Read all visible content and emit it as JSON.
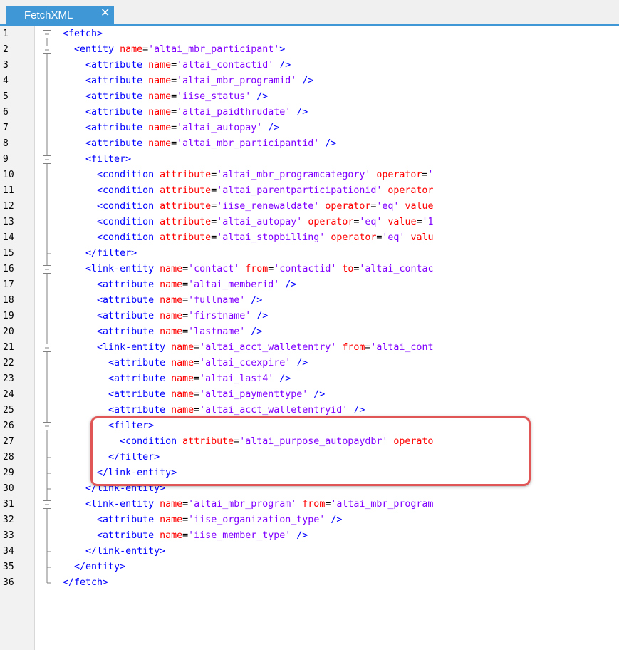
{
  "tab": {
    "label": "FetchXML",
    "close_glyph": "✕"
  },
  "colors": {
    "tag": "#0000ff",
    "attr_name": "#ff0000",
    "attr_value": "#8000ff",
    "highlight": "#e05555",
    "tab": "#3f97d6"
  },
  "lines": [
    {
      "num": "1",
      "indent": 0,
      "fold": "start",
      "tokens": [
        [
          "t",
          "<fetch>"
        ]
      ]
    },
    {
      "num": "2",
      "indent": 2,
      "fold": "start",
      "tokens": [
        [
          "t",
          "<entity"
        ],
        [
          "tx",
          " "
        ],
        [
          "a",
          "name"
        ],
        [
          "tx",
          "="
        ],
        [
          "v",
          "'altai_mbr_participant'"
        ],
        [
          "t",
          ">"
        ]
      ]
    },
    {
      "num": "3",
      "indent": 4,
      "fold": "line",
      "tokens": [
        [
          "t",
          "<attribute"
        ],
        [
          "tx",
          " "
        ],
        [
          "a",
          "name"
        ],
        [
          "tx",
          "="
        ],
        [
          "v",
          "'altai_contactid'"
        ],
        [
          "tx",
          " "
        ],
        [
          "t",
          "/>"
        ]
      ]
    },
    {
      "num": "4",
      "indent": 4,
      "fold": "line",
      "tokens": [
        [
          "t",
          "<attribute"
        ],
        [
          "tx",
          " "
        ],
        [
          "a",
          "name"
        ],
        [
          "tx",
          "="
        ],
        [
          "v",
          "'altai_mbr_programid'"
        ],
        [
          "tx",
          " "
        ],
        [
          "t",
          "/>"
        ]
      ]
    },
    {
      "num": "5",
      "indent": 4,
      "fold": "line",
      "tokens": [
        [
          "t",
          "<attribute"
        ],
        [
          "tx",
          " "
        ],
        [
          "a",
          "name"
        ],
        [
          "tx",
          "="
        ],
        [
          "v",
          "'iise_status'"
        ],
        [
          "tx",
          " "
        ],
        [
          "t",
          "/>"
        ]
      ]
    },
    {
      "num": "6",
      "indent": 4,
      "fold": "line",
      "tokens": [
        [
          "t",
          "<attribute"
        ],
        [
          "tx",
          " "
        ],
        [
          "a",
          "name"
        ],
        [
          "tx",
          "="
        ],
        [
          "v",
          "'altai_paidthrudate'"
        ],
        [
          "tx",
          " "
        ],
        [
          "t",
          "/>"
        ]
      ]
    },
    {
      "num": "7",
      "indent": 4,
      "fold": "line",
      "tokens": [
        [
          "t",
          "<attribute"
        ],
        [
          "tx",
          " "
        ],
        [
          "a",
          "name"
        ],
        [
          "tx",
          "="
        ],
        [
          "v",
          "'altai_autopay'"
        ],
        [
          "tx",
          " "
        ],
        [
          "t",
          "/>"
        ]
      ]
    },
    {
      "num": "8",
      "indent": 4,
      "fold": "line",
      "tokens": [
        [
          "t",
          "<attribute"
        ],
        [
          "tx",
          " "
        ],
        [
          "a",
          "name"
        ],
        [
          "tx",
          "="
        ],
        [
          "v",
          "'altai_mbr_participantid'"
        ],
        [
          "tx",
          " "
        ],
        [
          "t",
          "/>"
        ]
      ]
    },
    {
      "num": "9",
      "indent": 4,
      "fold": "start",
      "tokens": [
        [
          "t",
          "<filter>"
        ]
      ]
    },
    {
      "num": "10",
      "indent": 6,
      "fold": "line",
      "tokens": [
        [
          "t",
          "<condition"
        ],
        [
          "tx",
          " "
        ],
        [
          "a",
          "attribute"
        ],
        [
          "tx",
          "="
        ],
        [
          "v",
          "'altai_mbr_programcategory'"
        ],
        [
          "tx",
          " "
        ],
        [
          "a",
          "operator"
        ],
        [
          "tx",
          "="
        ],
        [
          "v",
          "'"
        ]
      ]
    },
    {
      "num": "11",
      "indent": 6,
      "fold": "line",
      "tokens": [
        [
          "t",
          "<condition"
        ],
        [
          "tx",
          " "
        ],
        [
          "a",
          "attribute"
        ],
        [
          "tx",
          "="
        ],
        [
          "v",
          "'altai_parentparticipationid'"
        ],
        [
          "tx",
          " "
        ],
        [
          "a",
          "operator"
        ]
      ]
    },
    {
      "num": "12",
      "indent": 6,
      "fold": "line",
      "tokens": [
        [
          "t",
          "<condition"
        ],
        [
          "tx",
          " "
        ],
        [
          "a",
          "attribute"
        ],
        [
          "tx",
          "="
        ],
        [
          "v",
          "'iise_renewaldate'"
        ],
        [
          "tx",
          " "
        ],
        [
          "a",
          "operator"
        ],
        [
          "tx",
          "="
        ],
        [
          "v",
          "'eq'"
        ],
        [
          "tx",
          " "
        ],
        [
          "a",
          "value"
        ]
      ]
    },
    {
      "num": "13",
      "indent": 6,
      "fold": "line",
      "tokens": [
        [
          "t",
          "<condition"
        ],
        [
          "tx",
          " "
        ],
        [
          "a",
          "attribute"
        ],
        [
          "tx",
          "="
        ],
        [
          "v",
          "'altai_autopay'"
        ],
        [
          "tx",
          " "
        ],
        [
          "a",
          "operator"
        ],
        [
          "tx",
          "="
        ],
        [
          "v",
          "'eq'"
        ],
        [
          "tx",
          " "
        ],
        [
          "a",
          "value"
        ],
        [
          "tx",
          "="
        ],
        [
          "v",
          "'1"
        ]
      ]
    },
    {
      "num": "14",
      "indent": 6,
      "fold": "line",
      "tokens": [
        [
          "t",
          "<condition"
        ],
        [
          "tx",
          " "
        ],
        [
          "a",
          "attribute"
        ],
        [
          "tx",
          "="
        ],
        [
          "v",
          "'altai_stopbilling'"
        ],
        [
          "tx",
          " "
        ],
        [
          "a",
          "operator"
        ],
        [
          "tx",
          "="
        ],
        [
          "v",
          "'eq'"
        ],
        [
          "tx",
          " "
        ],
        [
          "a",
          "valu"
        ]
      ]
    },
    {
      "num": "15",
      "indent": 4,
      "fold": "end",
      "tokens": [
        [
          "t",
          "</filter>"
        ]
      ]
    },
    {
      "num": "16",
      "indent": 4,
      "fold": "start",
      "tokens": [
        [
          "t",
          "<link-entity"
        ],
        [
          "tx",
          " "
        ],
        [
          "a",
          "name"
        ],
        [
          "tx",
          "="
        ],
        [
          "v",
          "'contact'"
        ],
        [
          "tx",
          " "
        ],
        [
          "a",
          "from"
        ],
        [
          "tx",
          "="
        ],
        [
          "v",
          "'contactid'"
        ],
        [
          "tx",
          " "
        ],
        [
          "a",
          "to"
        ],
        [
          "tx",
          "="
        ],
        [
          "v",
          "'altai_contac"
        ]
      ]
    },
    {
      "num": "17",
      "indent": 6,
      "fold": "line",
      "tokens": [
        [
          "t",
          "<attribute"
        ],
        [
          "tx",
          " "
        ],
        [
          "a",
          "name"
        ],
        [
          "tx",
          "="
        ],
        [
          "v",
          "'altai_memberid'"
        ],
        [
          "tx",
          " "
        ],
        [
          "t",
          "/>"
        ]
      ]
    },
    {
      "num": "18",
      "indent": 6,
      "fold": "line",
      "tokens": [
        [
          "t",
          "<attribute"
        ],
        [
          "tx",
          " "
        ],
        [
          "a",
          "name"
        ],
        [
          "tx",
          "="
        ],
        [
          "v",
          "'fullname'"
        ],
        [
          "tx",
          " "
        ],
        [
          "t",
          "/>"
        ]
      ]
    },
    {
      "num": "19",
      "indent": 6,
      "fold": "line",
      "tokens": [
        [
          "t",
          "<attribute"
        ],
        [
          "tx",
          " "
        ],
        [
          "a",
          "name"
        ],
        [
          "tx",
          "="
        ],
        [
          "v",
          "'firstname'"
        ],
        [
          "tx",
          " "
        ],
        [
          "t",
          "/>"
        ]
      ]
    },
    {
      "num": "20",
      "indent": 6,
      "fold": "line",
      "tokens": [
        [
          "t",
          "<attribute"
        ],
        [
          "tx",
          " "
        ],
        [
          "a",
          "name"
        ],
        [
          "tx",
          "="
        ],
        [
          "v",
          "'lastname'"
        ],
        [
          "tx",
          " "
        ],
        [
          "t",
          "/>"
        ]
      ]
    },
    {
      "num": "21",
      "indent": 6,
      "fold": "start",
      "tokens": [
        [
          "t",
          "<link-entity"
        ],
        [
          "tx",
          " "
        ],
        [
          "a",
          "name"
        ],
        [
          "tx",
          "="
        ],
        [
          "v",
          "'altai_acct_walletentry'"
        ],
        [
          "tx",
          " "
        ],
        [
          "a",
          "from"
        ],
        [
          "tx",
          "="
        ],
        [
          "v",
          "'altai_cont"
        ]
      ]
    },
    {
      "num": "22",
      "indent": 8,
      "fold": "line",
      "tokens": [
        [
          "t",
          "<attribute"
        ],
        [
          "tx",
          " "
        ],
        [
          "a",
          "name"
        ],
        [
          "tx",
          "="
        ],
        [
          "v",
          "'altai_ccexpire'"
        ],
        [
          "tx",
          " "
        ],
        [
          "t",
          "/>"
        ]
      ]
    },
    {
      "num": "23",
      "indent": 8,
      "fold": "line",
      "tokens": [
        [
          "t",
          "<attribute"
        ],
        [
          "tx",
          " "
        ],
        [
          "a",
          "name"
        ],
        [
          "tx",
          "="
        ],
        [
          "v",
          "'altai_last4'"
        ],
        [
          "tx",
          " "
        ],
        [
          "t",
          "/>"
        ]
      ]
    },
    {
      "num": "24",
      "indent": 8,
      "fold": "line",
      "tokens": [
        [
          "t",
          "<attribute"
        ],
        [
          "tx",
          " "
        ],
        [
          "a",
          "name"
        ],
        [
          "tx",
          "="
        ],
        [
          "v",
          "'altai_paymenttype'"
        ],
        [
          "tx",
          " "
        ],
        [
          "t",
          "/>"
        ]
      ]
    },
    {
      "num": "25",
      "indent": 8,
      "fold": "line",
      "tokens": [
        [
          "t",
          "<attribute"
        ],
        [
          "tx",
          " "
        ],
        [
          "a",
          "name"
        ],
        [
          "tx",
          "="
        ],
        [
          "v",
          "'altai_acct_walletentryid'"
        ],
        [
          "tx",
          " "
        ],
        [
          "t",
          "/>"
        ]
      ]
    },
    {
      "num": "26",
      "indent": 8,
      "fold": "start",
      "tokens": [
        [
          "t",
          "<filter>"
        ]
      ]
    },
    {
      "num": "27",
      "indent": 10,
      "fold": "line",
      "tokens": [
        [
          "t",
          "<condition"
        ],
        [
          "tx",
          " "
        ],
        [
          "a",
          "attribute"
        ],
        [
          "tx",
          "="
        ],
        [
          "v",
          "'altai_purpose_autopaydbr'"
        ],
        [
          "tx",
          " "
        ],
        [
          "a",
          "operato"
        ]
      ]
    },
    {
      "num": "28",
      "indent": 8,
      "fold": "end",
      "tokens": [
        [
          "t",
          "</filter>"
        ]
      ]
    },
    {
      "num": "29",
      "indent": 6,
      "fold": "end",
      "tokens": [
        [
          "t",
          "</link-entity>"
        ]
      ]
    },
    {
      "num": "30",
      "indent": 4,
      "fold": "end",
      "tokens": [
        [
          "t",
          "</link-entity>"
        ]
      ]
    },
    {
      "num": "31",
      "indent": 4,
      "fold": "start",
      "tokens": [
        [
          "t",
          "<link-entity"
        ],
        [
          "tx",
          " "
        ],
        [
          "a",
          "name"
        ],
        [
          "tx",
          "="
        ],
        [
          "v",
          "'altai_mbr_program'"
        ],
        [
          "tx",
          " "
        ],
        [
          "a",
          "from"
        ],
        [
          "tx",
          "="
        ],
        [
          "v",
          "'altai_mbr_program"
        ]
      ]
    },
    {
      "num": "32",
      "indent": 6,
      "fold": "line",
      "tokens": [
        [
          "t",
          "<attribute"
        ],
        [
          "tx",
          " "
        ],
        [
          "a",
          "name"
        ],
        [
          "tx",
          "="
        ],
        [
          "v",
          "'iise_organization_type'"
        ],
        [
          "tx",
          " "
        ],
        [
          "t",
          "/>"
        ]
      ]
    },
    {
      "num": "33",
      "indent": 6,
      "fold": "line",
      "tokens": [
        [
          "t",
          "<attribute"
        ],
        [
          "tx",
          " "
        ],
        [
          "a",
          "name"
        ],
        [
          "tx",
          "="
        ],
        [
          "v",
          "'iise_member_type'"
        ],
        [
          "tx",
          " "
        ],
        [
          "t",
          "/>"
        ]
      ]
    },
    {
      "num": "34",
      "indent": 4,
      "fold": "end",
      "tokens": [
        [
          "t",
          "</link-entity>"
        ]
      ]
    },
    {
      "num": "35",
      "indent": 2,
      "fold": "end",
      "tokens": [
        [
          "t",
          "</entity>"
        ]
      ]
    },
    {
      "num": "36",
      "indent": 0,
      "fold": "last",
      "tokens": [
        [
          "t",
          "</fetch>"
        ]
      ]
    }
  ]
}
